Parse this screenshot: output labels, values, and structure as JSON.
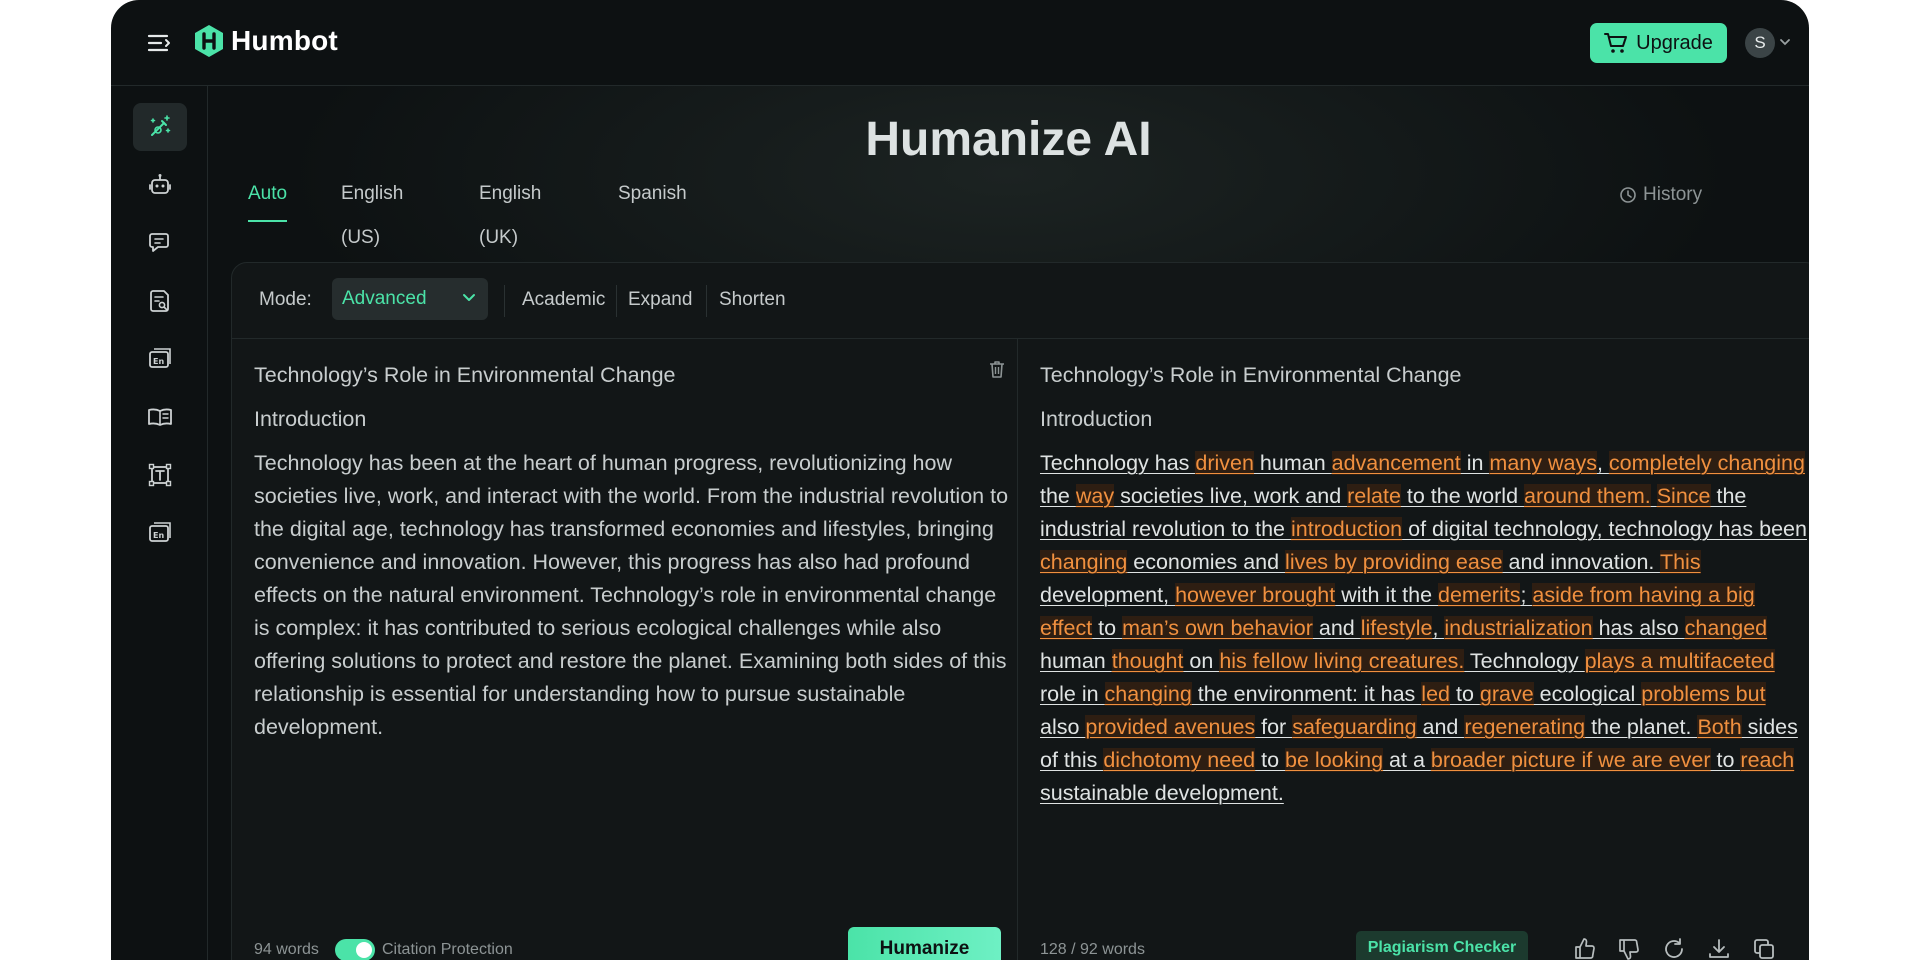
{
  "app": {
    "name": "Humbot"
  },
  "header": {
    "upgrade_label": "Upgrade",
    "avatar_initial": "S"
  },
  "page": {
    "title": "Humanize AI"
  },
  "languages": [
    "Auto",
    "English (US)",
    "English (UK)",
    "Spanish"
  ],
  "history_label": "History",
  "mode": {
    "label": "Mode:",
    "selected": "Advanced",
    "options": [
      "Academic",
      "Expand",
      "Shorten"
    ]
  },
  "input": {
    "title": "Technology’s Role in Environmental Change",
    "heading": "Introduction",
    "body": "Technology has been at the heart of human progress, revolutionizing how societies live, work, and interact with the world. From the industrial revolution to the digital age, technology has transformed economies and lifestyles, bringing convenience and innovation. However, this progress has also had profound effects on the natural environment. Technology’s role in environmental change is complex: it has contributed to serious ecological challenges while also offering solutions to protect and restore the planet. Examining both sides of this relationship is essential for understanding how to pursue sustainable development.",
    "word_count": "94 words",
    "citation_label": "Citation Protection",
    "citation_enabled": true,
    "humanize_label": "Humanize"
  },
  "output": {
    "title": "Technology’s Role in Environmental Change",
    "heading": "Introduction",
    "segments": [
      {
        "t": "Technology has ",
        "c": false
      },
      {
        "t": "driven",
        "c": true
      },
      {
        "t": " human ",
        "c": false
      },
      {
        "t": "advancement",
        "c": true
      },
      {
        "t": " in ",
        "c": false
      },
      {
        "t": "many ways",
        "c": true
      },
      {
        "t": ", ",
        "c": false
      },
      {
        "t": "completely changing",
        "c": true
      },
      {
        "t": " the ",
        "c": false
      },
      {
        "t": "way",
        "c": true
      },
      {
        "t": " societies live, work and ",
        "c": false
      },
      {
        "t": "relate",
        "c": true
      },
      {
        "t": " to the world ",
        "c": false
      },
      {
        "t": "around them.",
        "c": true
      },
      {
        "t": " ",
        "c": false
      },
      {
        "t": "Since",
        "c": true
      },
      {
        "t": " the industrial revolution to the ",
        "c": false
      },
      {
        "t": "introduction",
        "c": true
      },
      {
        "t": " of digital technology, technology has been ",
        "c": false
      },
      {
        "t": "changing",
        "c": true
      },
      {
        "t": " economies and ",
        "c": false
      },
      {
        "t": "lives by providing ease",
        "c": true
      },
      {
        "t": " and innovation. ",
        "c": false
      },
      {
        "t": "This",
        "c": true
      },
      {
        "t": " development, ",
        "c": false
      },
      {
        "t": "however brought",
        "c": true
      },
      {
        "t": " with it the ",
        "c": false
      },
      {
        "t": "demerits",
        "c": true
      },
      {
        "t": "; ",
        "c": false
      },
      {
        "t": "aside from having a big effect",
        "c": true
      },
      {
        "t": " to ",
        "c": false
      },
      {
        "t": "man’s own behavior",
        "c": true
      },
      {
        "t": " and ",
        "c": false
      },
      {
        "t": "lifestyle",
        "c": true
      },
      {
        "t": ", ",
        "c": false
      },
      {
        "t": "industrialization",
        "c": true
      },
      {
        "t": " has also ",
        "c": false
      },
      {
        "t": "changed",
        "c": true
      },
      {
        "t": " human ",
        "c": false
      },
      {
        "t": "thought",
        "c": true
      },
      {
        "t": " on ",
        "c": false
      },
      {
        "t": "his fellow living creatures.",
        "c": true
      },
      {
        "t": " Technology ",
        "c": false
      },
      {
        "t": "plays a multifaceted",
        "c": true
      },
      {
        "t": " role in ",
        "c": false
      },
      {
        "t": "changing",
        "c": true
      },
      {
        "t": " the environment: it has ",
        "c": false
      },
      {
        "t": "led",
        "c": true
      },
      {
        "t": " to ",
        "c": false
      },
      {
        "t": "grave",
        "c": true
      },
      {
        "t": " ecological ",
        "c": false
      },
      {
        "t": "problems but",
        "c": true
      },
      {
        "t": " also ",
        "c": false
      },
      {
        "t": "provided avenues",
        "c": true
      },
      {
        "t": " for ",
        "c": false
      },
      {
        "t": "safeguarding",
        "c": true
      },
      {
        "t": " and ",
        "c": false
      },
      {
        "t": "regenerating",
        "c": true
      },
      {
        "t": " the planet. ",
        "c": false
      },
      {
        "t": "Both",
        "c": true
      },
      {
        "t": " sides of this ",
        "c": false
      },
      {
        "t": "dichotomy need",
        "c": true
      },
      {
        "t": " to ",
        "c": false
      },
      {
        "t": "be looking",
        "c": true
      },
      {
        "t": " at a ",
        "c": false
      },
      {
        "t": "broader picture if we are ever",
        "c": true
      },
      {
        "t": " to ",
        "c": false
      },
      {
        "t": "reach",
        "c": true
      },
      {
        "t": " sustainable development.",
        "c": false
      }
    ],
    "word_count": "128 / 92 words",
    "plagiarism_label": "Plagiarism Checker"
  },
  "colors": {
    "accent": "#4be3a8",
    "changed": "#f0903f",
    "background": "#0d1112"
  }
}
